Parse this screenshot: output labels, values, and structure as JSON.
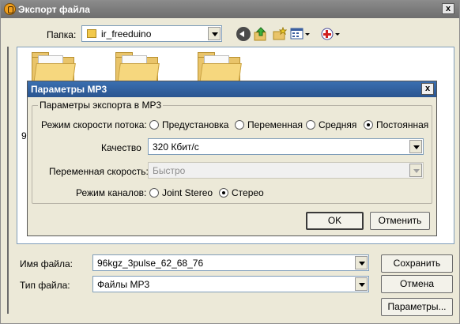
{
  "window": {
    "title": "Экспорт файла",
    "close_label": "x"
  },
  "toolbar": {
    "folder_label": "Папка:",
    "folder_value": "ir_freeduino"
  },
  "file_list": {
    "partial_item": "9"
  },
  "bottom": {
    "filename_label": "Имя файла:",
    "filename_value": "96kgz_3pulse_62_68_76",
    "filetype_label": "Тип файла:",
    "filetype_value": "Файлы MP3",
    "save_label": "Сохранить",
    "cancel_label": "Отмена",
    "options_label": "Параметры..."
  },
  "dialog": {
    "title": "Параметры MP3",
    "close_label": "x",
    "group_caption": "Параметры экспорта в MP3",
    "bitrate_mode_label": "Режим скорости потока:",
    "bitrate_modes": [
      "Предустановка",
      "Переменная",
      "Средняя",
      "Постоянная"
    ],
    "bitrate_mode_selected": "Постоянная",
    "quality_label": "Качество",
    "quality_value": "320 Кбит/с",
    "variable_speed_label": "Переменная скорость:",
    "variable_speed_value": "Быстро",
    "channel_mode_label": "Режим каналов:",
    "channel_modes": [
      "Joint Stereo",
      "Стерео"
    ],
    "channel_mode_selected": "Стерео",
    "ok_label": "OK",
    "cancel_label": "Отменить"
  }
}
